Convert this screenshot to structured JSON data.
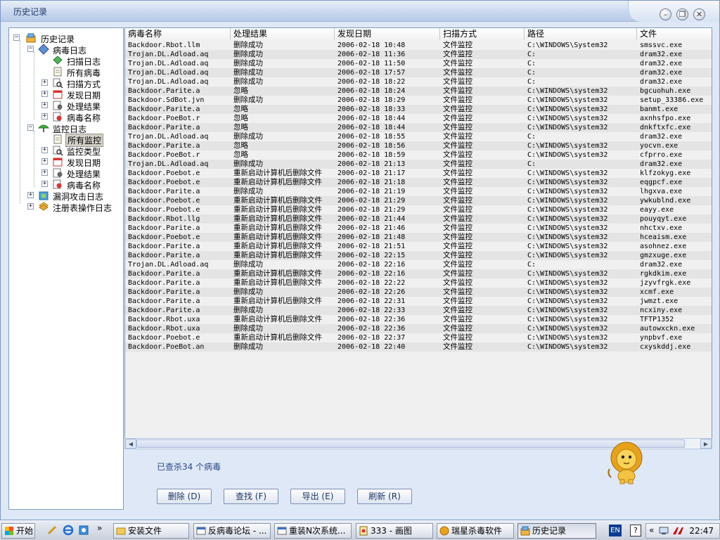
{
  "window": {
    "title": "历史记录"
  },
  "tree": {
    "root": "历史记录",
    "virus_log": "病毒日志",
    "scan_log": "扫描日志",
    "all_virus": "所有病毒",
    "scan_method": "扫描方式",
    "found_date": "发现日期",
    "process_result": "处理结果",
    "virus_name": "病毒名称",
    "monitor_log": "监控日志",
    "all_monitor": "所有监控",
    "monitor_type": "监控类型",
    "m_found_date": "发现日期",
    "m_process_result": "处理结果",
    "m_virus_name": "病毒名称",
    "vuln_log": "漏洞攻击日志",
    "registry_log": "注册表操作日志"
  },
  "columns": [
    "病毒名称",
    "处理结果",
    "发现日期",
    "扫描方式",
    "路径",
    "文件"
  ],
  "rows": [
    [
      "Backdoor.Rbot.llm",
      "删除成功",
      "2006-02-18 10:48",
      "文件监控",
      "C:\\WINDOWS\\System32",
      "smssvc.exe"
    ],
    [
      "Trojan.DL.Adload.aq",
      "删除成功",
      "2006-02-18 11:36",
      "文件监控",
      "C:",
      "dram32.exe"
    ],
    [
      "Trojan.DL.Adload.aq",
      "删除成功",
      "2006-02-18 11:50",
      "文件监控",
      "C:",
      "dram32.exe"
    ],
    [
      "Trojan.DL.Adload.aq",
      "删除成功",
      "2006-02-18 17:57",
      "文件监控",
      "C:",
      "dram32.exe"
    ],
    [
      "Trojan.DL.Adload.aq",
      "删除成功",
      "2006-02-18 18:22",
      "文件监控",
      "C:",
      "dram32.exe"
    ],
    [
      "Backdoor.Parite.a",
      "忽略",
      "2006-02-18 18:24",
      "文件监控",
      "C:\\WINDOWS\\system32",
      "bgcuohuh.exe"
    ],
    [
      "Backdoor.SdBot.jvn",
      "删除成功",
      "2006-02-18 18:29",
      "文件监控",
      "C:\\WINDOWS\\system32",
      "setup_33386.exe"
    ],
    [
      "Backdoor.Parite.a",
      "忽略",
      "2006-02-18 18:33",
      "文件监控",
      "C:\\WINDOWS\\system32",
      "banmt.exe"
    ],
    [
      "Backdoor.PoeBot.r",
      "忽略",
      "2006-02-18 18:44",
      "文件监控",
      "C:\\WINDOWS\\system32",
      "axnhsfpo.exe"
    ],
    [
      "Backdoor.Parite.a",
      "忽略",
      "2006-02-18 18:44",
      "文件监控",
      "C:\\WINDOWS\\system32",
      "dnkftxfc.exe"
    ],
    [
      "Trojan.DL.Adload.aq",
      "删除成功",
      "2006-02-18 18:55",
      "文件监控",
      "C:",
      "dram32.exe"
    ],
    [
      "Backdoor.Parite.a",
      "忽略",
      "2006-02-18 18:56",
      "文件监控",
      "C:\\WINDOWS\\system32",
      "yocvn.exe"
    ],
    [
      "Backdoor.PoeBot.r",
      "忽略",
      "2006-02-18 18:59",
      "文件监控",
      "C:\\WINDOWS\\system32",
      "cfprro.exe"
    ],
    [
      "Trojan.DL.Adload.aq",
      "删除成功",
      "2006-02-18 21:13",
      "文件监控",
      "C:",
      "dram32.exe"
    ],
    [
      "Backdoor.Poebot.e",
      "重新启动计算机后删除文件",
      "2006-02-18 21:17",
      "文件监控",
      "C:\\WINDOWS\\system32",
      "klfzokyg.exe"
    ],
    [
      "Backdoor.Poebot.e",
      "重新启动计算机后删除文件",
      "2006-02-18 21:18",
      "文件监控",
      "C:\\WINDOWS\\system32",
      "eqgpcf.exe"
    ],
    [
      "Backdoor.Parite.a",
      "删除成功",
      "2006-02-18 21:19",
      "文件监控",
      "C:\\WINDOWS\\system32",
      "lhgxva.exe"
    ],
    [
      "Backdoor.Poebot.e",
      "重新启动计算机后删除文件",
      "2006-02-18 21:29",
      "文件监控",
      "C:\\WINDOWS\\system32",
      "ywkublnd.exe"
    ],
    [
      "Backdoor.Poebot.e",
      "重新启动计算机后删除文件",
      "2006-02-18 21:29",
      "文件监控",
      "C:\\WINDOWS\\system32",
      "eayy.exe"
    ],
    [
      "Backdoor.Rbot.llg",
      "重新启动计算机后删除文件",
      "2006-02-18 21:44",
      "文件监控",
      "C:\\WINDOWS\\system32",
      "pouyqyt.exe"
    ],
    [
      "Backdoor.Parite.a",
      "重新启动计算机后删除文件",
      "2006-02-18 21:46",
      "文件监控",
      "C:\\WINDOWS\\system32",
      "nhctxv.exe"
    ],
    [
      "Backdoor.Poebot.e",
      "重新启动计算机后删除文件",
      "2006-02-18 21:48",
      "文件监控",
      "C:\\WINDOWS\\system32",
      "hceaism.exe"
    ],
    [
      "Backdoor.Parite.a",
      "重新启动计算机后删除文件",
      "2006-02-18 21:51",
      "文件监控",
      "C:\\WINDOWS\\system32",
      "asohnez.exe"
    ],
    [
      "Backdoor.Parite.a",
      "重新启动计算机后删除文件",
      "2006-02-18 22:15",
      "文件监控",
      "C:\\WINDOWS\\system32",
      "gmzxuge.exe"
    ],
    [
      "Trojan.DL.Adload.aq",
      "删除成功",
      "2006-02-18 22:16",
      "文件监控",
      "C:",
      "dram32.exe"
    ],
    [
      "Backdoor.Parite.a",
      "重新启动计算机后删除文件",
      "2006-02-18 22:16",
      "文件监控",
      "C:\\WINDOWS\\system32",
      "rgkdkim.exe"
    ],
    [
      "Backdoor.Parite.a",
      "重新启动计算机后删除文件",
      "2006-02-18 22:22",
      "文件监控",
      "C:\\WINDOWS\\system32",
      "jzyvfrgk.exe"
    ],
    [
      "Backdoor.Parite.a",
      "删除成功",
      "2006-02-18 22:26",
      "文件监控",
      "C:\\WINDOWS\\system32",
      "xcmf.exe"
    ],
    [
      "Backdoor.Parite.a",
      "重新启动计算机后删除文件",
      "2006-02-18 22:31",
      "文件监控",
      "C:\\WINDOWS\\system32",
      "jwmzt.exe"
    ],
    [
      "Backdoor.Parite.a",
      "删除成功",
      "2006-02-18 22:33",
      "文件监控",
      "C:\\WINDOWS\\system32",
      "ncxiny.exe"
    ],
    [
      "Backdoor.Rbot.uxa",
      "重新启动计算机后删除文件",
      "2006-02-18 22:36",
      "文件监控",
      "C:\\WINDOWS\\system32",
      "TFTP1352"
    ],
    [
      "Backdoor.Rbot.uxa",
      "删除成功",
      "2006-02-18 22:36",
      "文件监控",
      "C:\\WINDOWS\\system32",
      "autowxckn.exe"
    ],
    [
      "Backdoor.Poebot.e",
      "重新启动计算机后删除文件",
      "2006-02-18 22:37",
      "文件监控",
      "C:\\WINDOWS\\system32",
      "ynpbvf.exe"
    ],
    [
      "Backdoor.PoeBot.an",
      "删除成功",
      "2006-02-18 22:40",
      "文件监控",
      "C:\\WINDOWS\\system32",
      "cxyskddj.exe"
    ]
  ],
  "status": "已查杀34 个病毒",
  "buttons": {
    "delete": "删除 (D)",
    "find": "查找 (F)",
    "export": "导出 (E)",
    "refresh": "刷新 (R)"
  },
  "taskbar": {
    "start": "开始",
    "tasks": [
      "安装文件",
      "反病毒论坛 - ...",
      "重装N次系统...",
      "333 - 画图",
      "瑞星杀毒软件",
      "历史记录"
    ],
    "lang": "EN",
    "help": "?",
    "tray_arrow": "«",
    "clock": "22:47"
  },
  "colors": {
    "accent": "#2b4a8a",
    "window_bg": "#dfe8f6"
  }
}
